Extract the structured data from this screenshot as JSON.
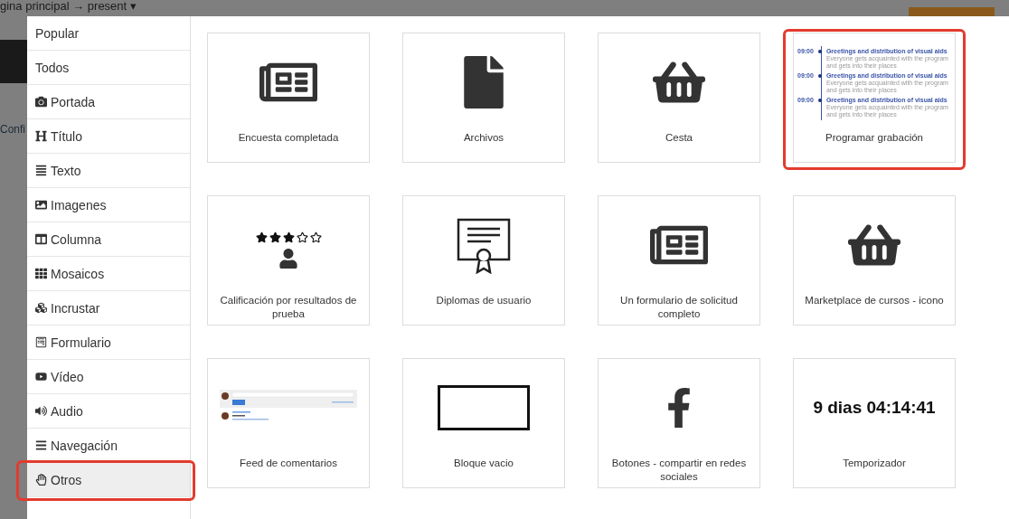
{
  "background": {
    "breadcrumb": "gina principal → present ▾",
    "side_label": "Confi"
  },
  "sidebar": {
    "items": [
      {
        "label": "Popular",
        "selected": false,
        "highlighted": false
      },
      {
        "label": "Todos",
        "selected": false,
        "highlighted": false
      },
      {
        "label": "Portada",
        "selected": false,
        "highlighted": false
      },
      {
        "label": "Título",
        "selected": false,
        "highlighted": false
      },
      {
        "label": "Texto",
        "selected": false,
        "highlighted": false
      },
      {
        "label": "Imagenes",
        "selected": false,
        "highlighted": false
      },
      {
        "label": "Columna",
        "selected": false,
        "highlighted": false
      },
      {
        "label": "Mosaicos",
        "selected": false,
        "highlighted": false
      },
      {
        "label": "Incrustar",
        "selected": false,
        "highlighted": false
      },
      {
        "label": "Formulario",
        "selected": false,
        "highlighted": false
      },
      {
        "label": "Vídeo",
        "selected": false,
        "highlighted": false
      },
      {
        "label": "Audio",
        "selected": false,
        "highlighted": false
      },
      {
        "label": "Navegación",
        "selected": false,
        "highlighted": false
      },
      {
        "label": "Otros",
        "selected": true,
        "highlighted": true
      }
    ]
  },
  "tiles": [
    {
      "kind": "newspaper",
      "label": "Encuesta completada",
      "highlighted": false
    },
    {
      "kind": "file",
      "label": "Archivos",
      "highlighted": false
    },
    {
      "kind": "basket",
      "label": "Cesta",
      "highlighted": false
    },
    {
      "kind": "schedule",
      "label": "Programar grabación",
      "highlighted": true,
      "entries": [
        {
          "time": "09:00",
          "title": "Greetings and distribution of visual aids",
          "text": "Everyone gets acquainted with the program and gets into their places"
        },
        {
          "time": "09:00",
          "title": "Greetings and distribution of visual aids",
          "text": "Everyone gets acquainted with the program and gets into their places"
        },
        {
          "time": "09:00",
          "title": "Greetings and distribution of visual aids",
          "text": "Everyone gets acquainted with the program and gets into their places"
        }
      ]
    },
    {
      "kind": "rating",
      "label": "Calificación por resultados de prueba",
      "highlighted": false,
      "stars": 3
    },
    {
      "kind": "diploma",
      "label": "Diplomas de usuario",
      "highlighted": false
    },
    {
      "kind": "newspaper",
      "label": "Un formulario de solicitud completo",
      "highlighted": false
    },
    {
      "kind": "basket",
      "label": "Marketplace de cursos - icono",
      "highlighted": false
    },
    {
      "kind": "feed",
      "label": "Feed de comentarios",
      "highlighted": false
    },
    {
      "kind": "empty",
      "label": "Bloque vacio",
      "highlighted": false
    },
    {
      "kind": "share",
      "label": "Botones - compartir en redes sociales",
      "highlighted": false
    },
    {
      "kind": "timer",
      "label": "Temporizador",
      "highlighted": false,
      "value": "9 dias 04:14:41"
    }
  ]
}
